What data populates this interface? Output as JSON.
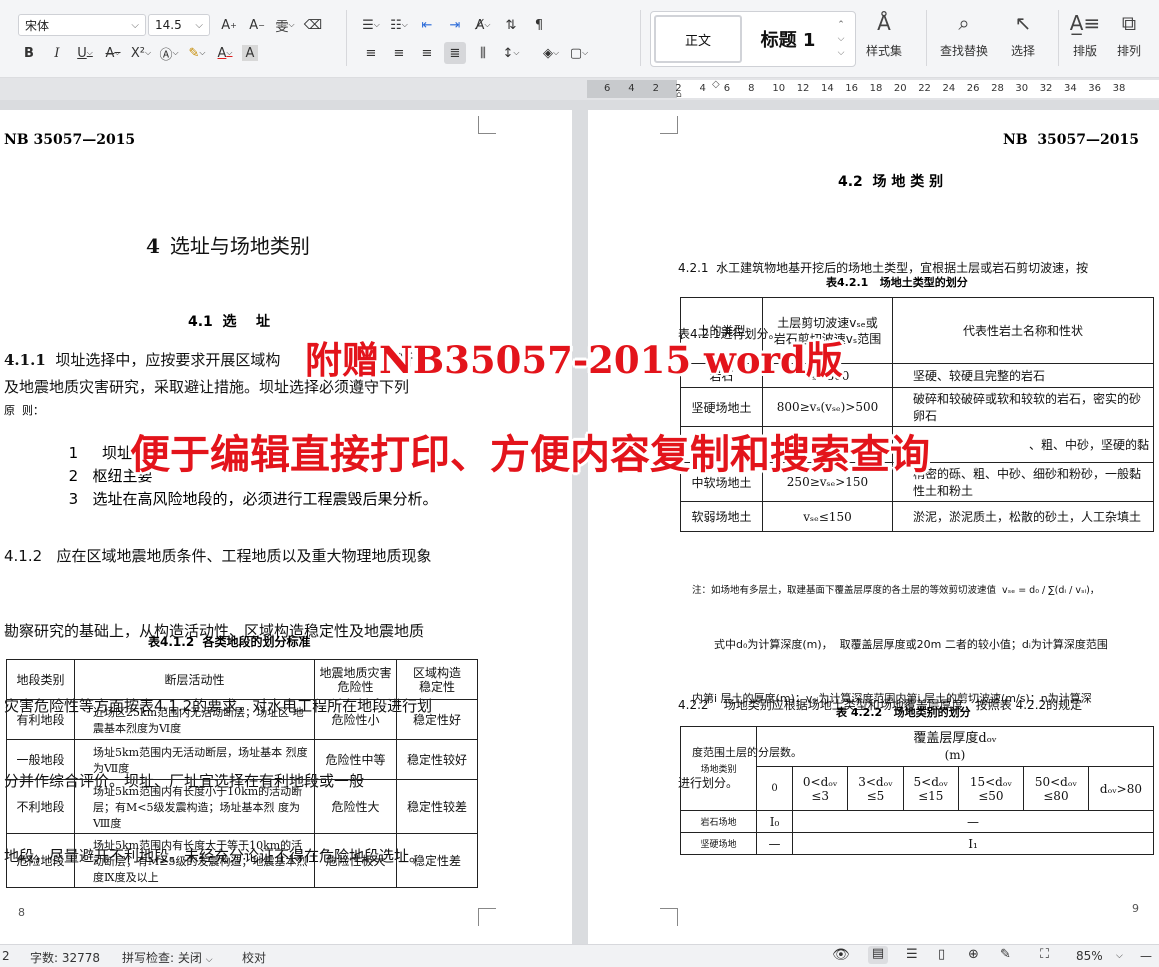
{
  "toolbar": {
    "font_name": "宋体",
    "font_size": "14.5",
    "style_normal": "正文",
    "style_heading1": "标题 1",
    "styles_set_label": "样式集",
    "find_replace_label": "查找替换",
    "select_label": "选择",
    "layout_label": "排版",
    "arrange_label": "排列"
  },
  "ruler": {
    "ticks": [
      "6",
      "4",
      "2",
      "2",
      "4",
      "6",
      "8",
      "10",
      "12",
      "14",
      "16",
      "18",
      "20",
      "22",
      "24",
      "26",
      "28",
      "30",
      "32",
      "34",
      "36",
      "38"
    ]
  },
  "left_page": {
    "header": "NB  35057—2015",
    "chapter_num": "4",
    "chapter_title": "选址与场地类别",
    "section_title": "4.1  选    址",
    "p411_num": "4.1.1",
    "p411_line1": "坝址选择中，应按要求开展区域构",
    "p411_line1_end": "断",
    "p411_line2": "及地震地质灾害研究，采取避让措施。坝址选择必须遵守下列",
    "p411_line3": "原  则：",
    "item1_num": "1",
    "item1_text": "坝址不",
    "item2_num": "2",
    "item2_text": "枢纽主要",
    "item3_num": "3",
    "item3_text": "选址在高风险地段的，必须进行工程震毁后果分析。",
    "p412_line1": "4.1.2   应在区域地震地质条件、工程地质以及重大物理地质现象",
    "p412_line2": "勘察研究的基础上，从构造活动性、区域构造稳定性及地震地质",
    "p412_line3": "灾害危险性等方面按表4.1.2的要求，对水电工程所在地段进行划",
    "p412_line4": "分并作综合评价。坝址、厂址宜选择在有利地段或一般",
    "p412_line5": "地段，尽量避开不利地段。未经充分论证不得在危险地段选址。",
    "table_caption": "表4.1.2  各类地段的划分标准",
    "table_head": [
      "地段类别",
      "断层活动性",
      "地震地质灾害\n危险性",
      "区域构造\n稳定性"
    ],
    "table_rows": [
      [
        "有利地段",
        "近场区25km范围内无活动断层；场址区 地震基本烈度为Ⅵ度",
        "危险性小",
        "稳定性好"
      ],
      [
        "一般地段",
        "场址5km范围内无活动断层，场址基本 烈度为Ⅶ度",
        "危险性中等",
        "稳定性较好"
      ],
      [
        "不利地段",
        "场址5km范围内有长度小于10km的活动断层；有M<5级发震构造；场址基本烈 度为Ⅷ度",
        "危险性大",
        "稳定性较差"
      ],
      [
        "危险地段",
        "场址5km范围内有长度大于等于10km的活动断层；有M≥5级的发震构造；地震基本烈度Ⅸ度及以上",
        "危险性极大",
        "稳定性差"
      ]
    ],
    "page_number": "8"
  },
  "right_page": {
    "header": "NB  35057—2015",
    "section_title": "4.2  场 地 类 别",
    "p421_line1": "4.2.1  水工建筑物地基开挖后的场地土类型，宜根据土层或岩石剪切波速，按",
    "p421_line2": "表4.2.1进行划分。",
    "table1_caption": "表4.2.1   场地土类型的划分",
    "table1_head": [
      "土的类型",
      "土层剪切波速vₛₑ或\n岩石剪切波速vₛ范围",
      "代表性岩土名称和性状"
    ],
    "table1_rows": [
      [
        "岩石",
        "vₛ>800",
        "坚硬、较硬且完整的岩石"
      ],
      [
        "坚硬场地土",
        "800≥vₛ(vₛₑ)>500",
        "破碎和较破碎或软和较软的岩石，密实的砂卵石"
      ],
      [
        "",
        "",
        "、粗、中砂，坚硬的黏"
      ],
      [
        "中软场地土",
        "250≥vₛₑ>150",
        "稍密的砾、粗、中砂、细砂和粉砂，一般黏性土和粉土"
      ],
      [
        "软弱场地土",
        "vₛₑ≤150",
        "淤泥，淤泥质土，松散的砂土，人工杂填土"
      ]
    ],
    "note_line1": "注：如场地有多层土，取建基面下覆盖层厚度的各土层的等效剪切波速值  vₛₑ = d₀ / ∑(dᵢ / vₛᵢ)，",
    "note_line2": "式中d₀为计算深度(m)，  取覆盖层厚度或20m 二者的较小值；dᵢ为计算深度范围",
    "note_line3": "内第i 层土的厚度(m)；vₛᵢ为计算深度范围内第i 层土的剪切波速(m/s)；n为计算深",
    "note_line4": "度范围土层的分层数。",
    "p422_line1": "4.2.2    场地类别应根据场地土类型和场地覆盖层厚度，按照表 4.2.2的规定",
    "p422_line2": "进行划分。",
    "table2_caption": "表 4.2.2   场地类别的划分",
    "table2_corner": "场地类别",
    "table2_top": "覆盖层厚度dₒᵥ",
    "table2_unit": "(m)",
    "table2_cols": [
      "0",
      "0<dₒᵥ\n≤3",
      "3<dₒᵥ\n≤5",
      "5<dₒᵥ\n≤15",
      "15<dₒᵥ\n≤50",
      "50<dₒᵥ\n≤80",
      "dₒᵥ>80"
    ],
    "table2_rows": [
      [
        "岩石场地",
        "I₀",
        "—"
      ],
      [
        "坚硬场地",
        "—",
        "I₁"
      ]
    ],
    "page_number": "9"
  },
  "watermark": {
    "line1": "附赠NB35057-2015 word版",
    "line2": "便于编辑直接打印、方便内容复制和搜索查询"
  },
  "status": {
    "page": "2",
    "word_count": "字数: 32778",
    "spell_check": "拼写检查: 关闭",
    "proofread": "校对",
    "zoom": "85%"
  }
}
